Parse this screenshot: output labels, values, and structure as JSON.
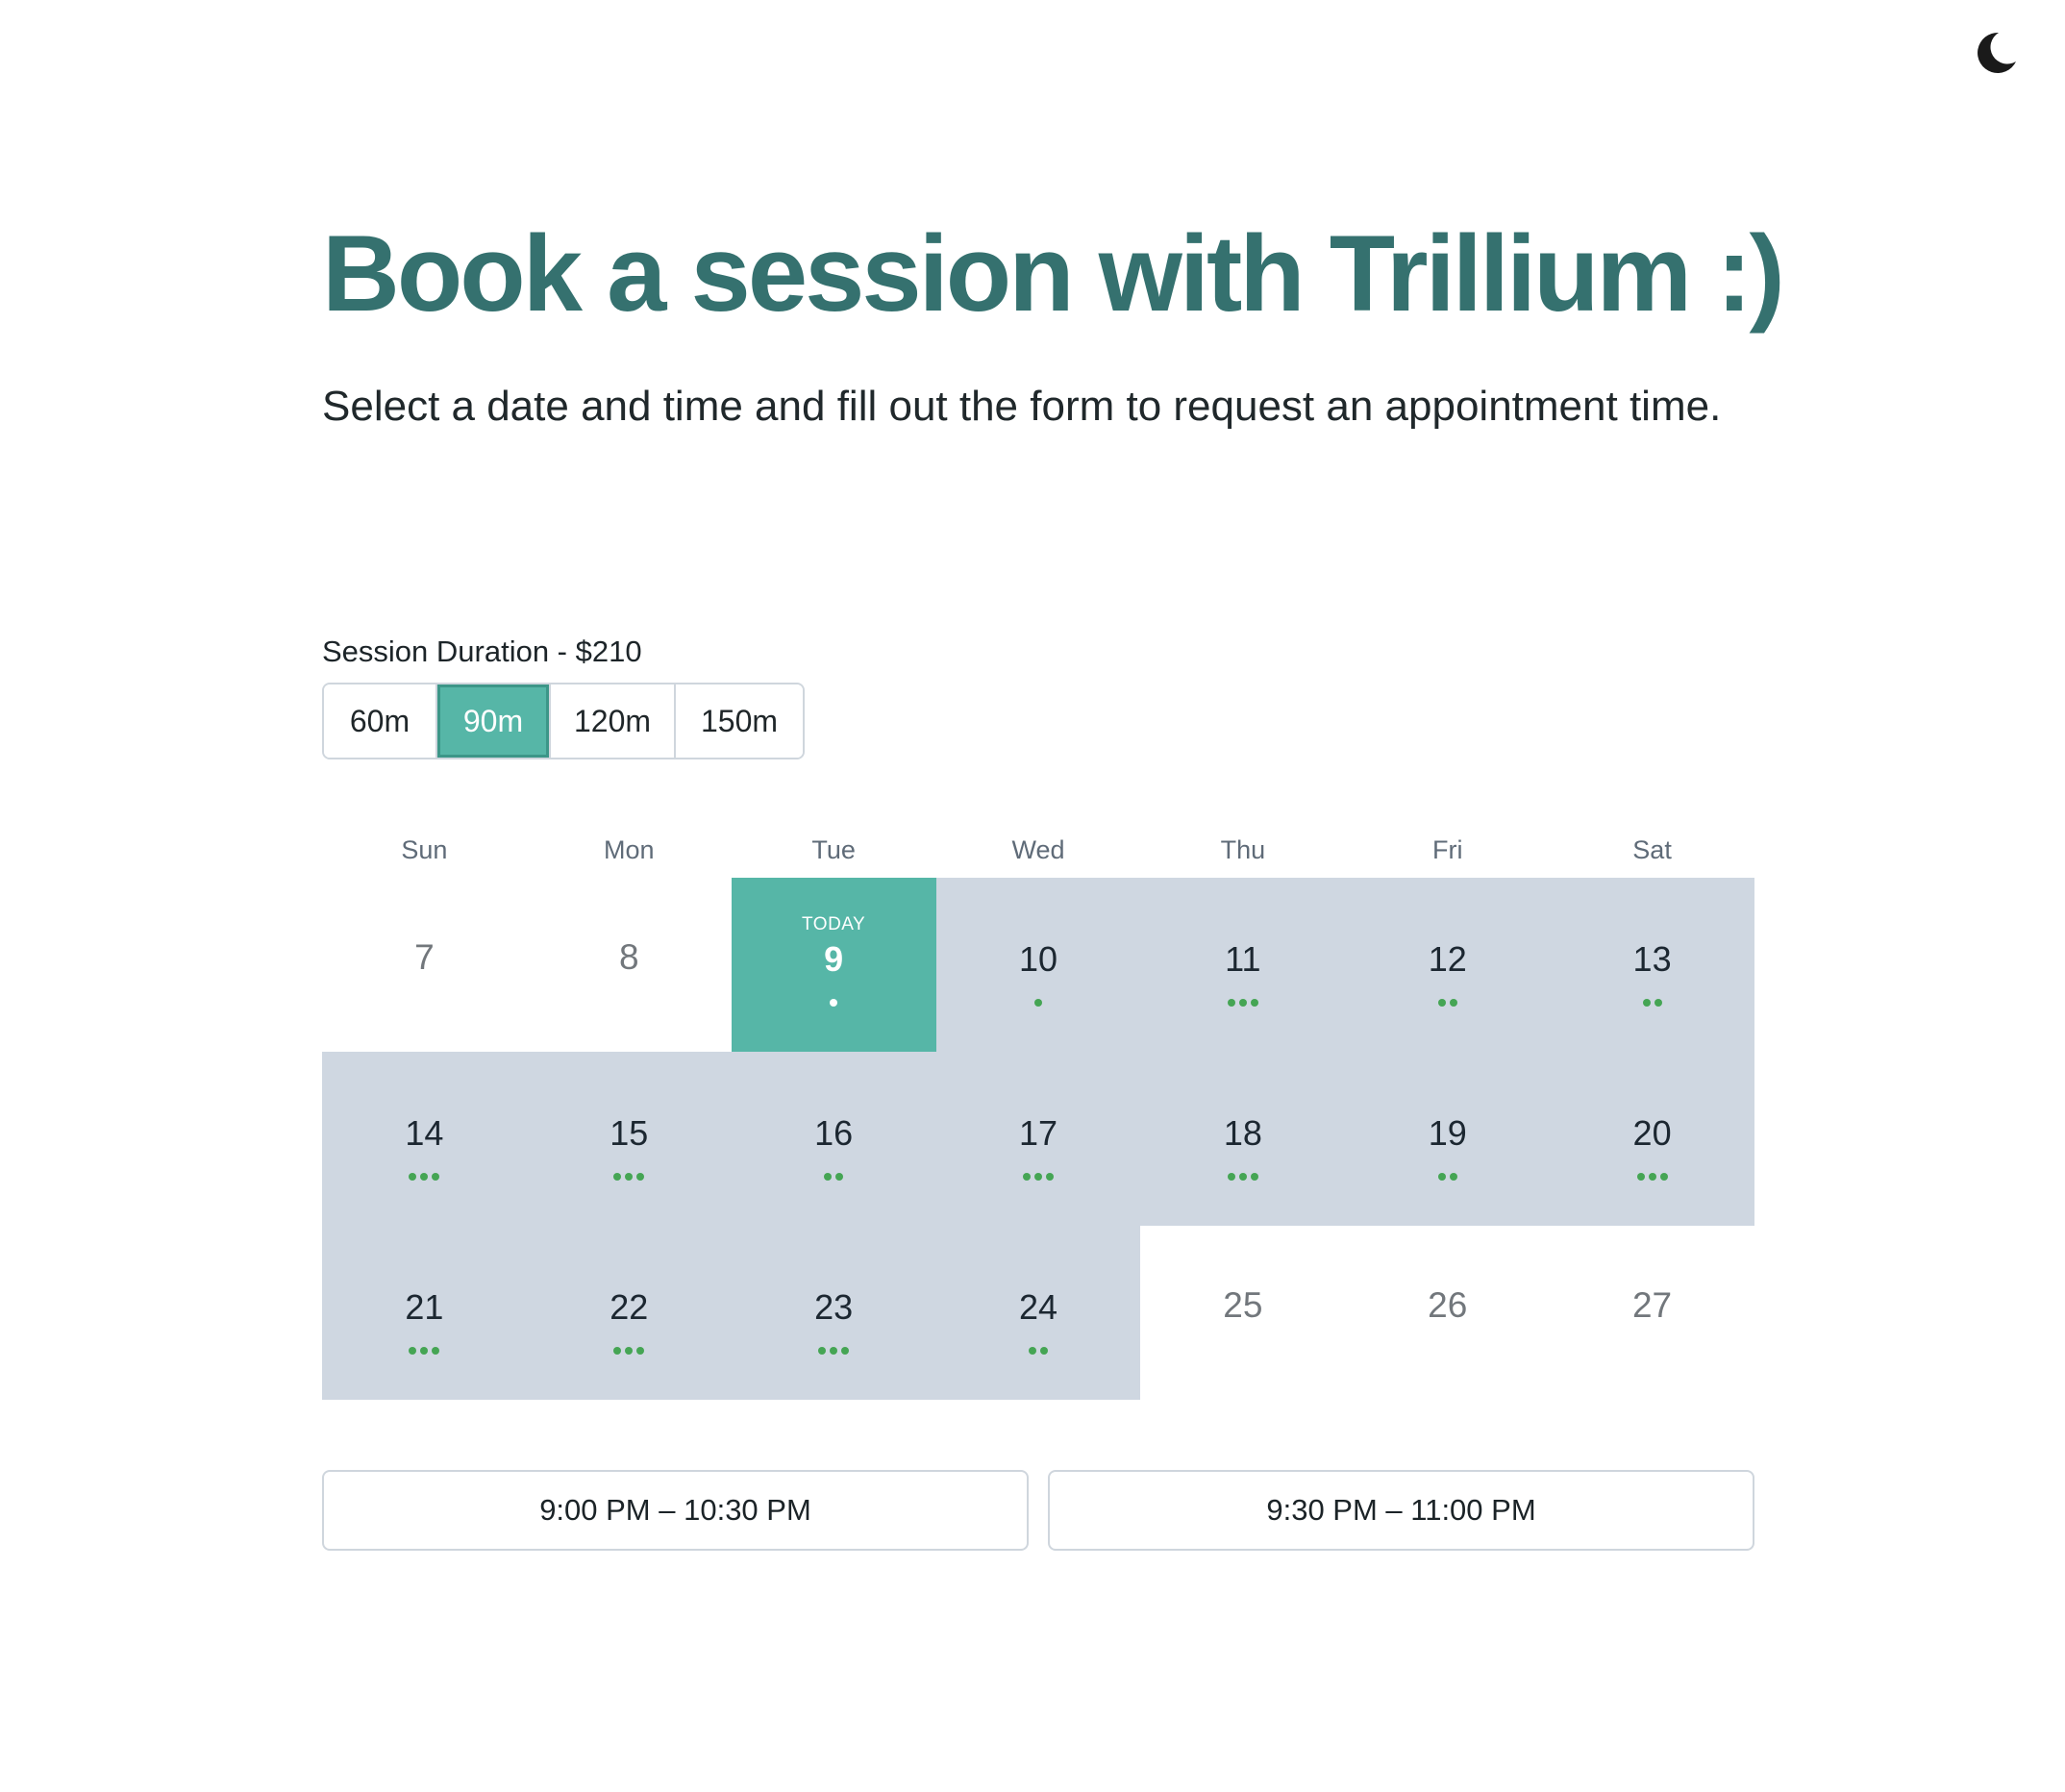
{
  "header": {
    "title": "Book a session with Trillium :)",
    "subtitle": "Select a date and time and fill out the form to request an appointment time.",
    "theme_toggle_icon": "moon-icon"
  },
  "duration": {
    "label": "Session Duration - $210",
    "options": [
      {
        "label": "60m",
        "selected": false
      },
      {
        "label": "90m",
        "selected": true
      },
      {
        "label": "120m",
        "selected": false
      },
      {
        "label": "150m",
        "selected": false
      }
    ]
  },
  "calendar": {
    "weekdays": [
      "Sun",
      "Mon",
      "Tue",
      "Wed",
      "Thu",
      "Fri",
      "Sat"
    ],
    "today_label": "TODAY",
    "days": [
      {
        "number": "7",
        "state": "disabled",
        "dots": 0
      },
      {
        "number": "8",
        "state": "disabled",
        "dots": 0
      },
      {
        "number": "9",
        "state": "today",
        "dots": 1
      },
      {
        "number": "10",
        "state": "available",
        "dots": 1
      },
      {
        "number": "11",
        "state": "available",
        "dots": 3
      },
      {
        "number": "12",
        "state": "available",
        "dots": 2
      },
      {
        "number": "13",
        "state": "available",
        "dots": 2
      },
      {
        "number": "14",
        "state": "available",
        "dots": 3
      },
      {
        "number": "15",
        "state": "available",
        "dots": 3
      },
      {
        "number": "16",
        "state": "available",
        "dots": 2
      },
      {
        "number": "17",
        "state": "available",
        "dots": 3
      },
      {
        "number": "18",
        "state": "available",
        "dots": 3
      },
      {
        "number": "19",
        "state": "available",
        "dots": 2
      },
      {
        "number": "20",
        "state": "available",
        "dots": 3
      },
      {
        "number": "21",
        "state": "available",
        "dots": 3
      },
      {
        "number": "22",
        "state": "available",
        "dots": 3
      },
      {
        "number": "23",
        "state": "available",
        "dots": 3
      },
      {
        "number": "24",
        "state": "available",
        "dots": 2
      },
      {
        "number": "25",
        "state": "disabled",
        "dots": 0
      },
      {
        "number": "26",
        "state": "disabled",
        "dots": 0
      },
      {
        "number": "27",
        "state": "disabled",
        "dots": 0
      }
    ]
  },
  "time_slots": [
    {
      "label": "9:00 PM – 10:30 PM"
    },
    {
      "label": "9:30 PM – 11:00 PM"
    }
  ],
  "colors": {
    "title": "#35716f",
    "accent": "#56b6a7",
    "available_day": "#cfd7e1",
    "availability_dot": "#45a554"
  }
}
